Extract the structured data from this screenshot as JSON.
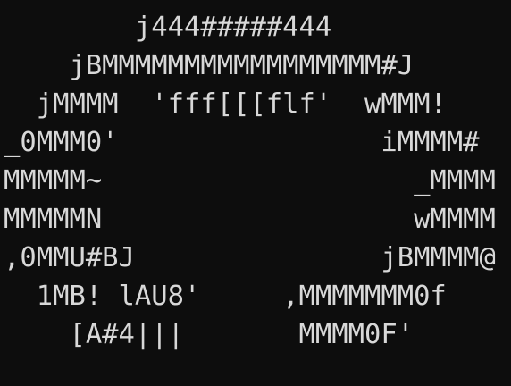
{
  "art": {
    "lines": [
      "        j444#####444",
      "    jBMMMMMMMMMMMMMMMMM#J",
      "  jMMMM  'fff[[[flf'  wMMM!",
      "_0MMM0'                iMMMM#",
      "MMMMM~                   _MMMM",
      "MMMMMN                   wMMMM",
      ",0MMU#BJ               jBMMMM@",
      "  1MB! lAU8'     ,MMMMMMM0f",
      "    [A#4|||       MMMM0F'"
    ]
  },
  "colors": {
    "background": "#0d0d0d",
    "text": "#d8d8d8"
  }
}
